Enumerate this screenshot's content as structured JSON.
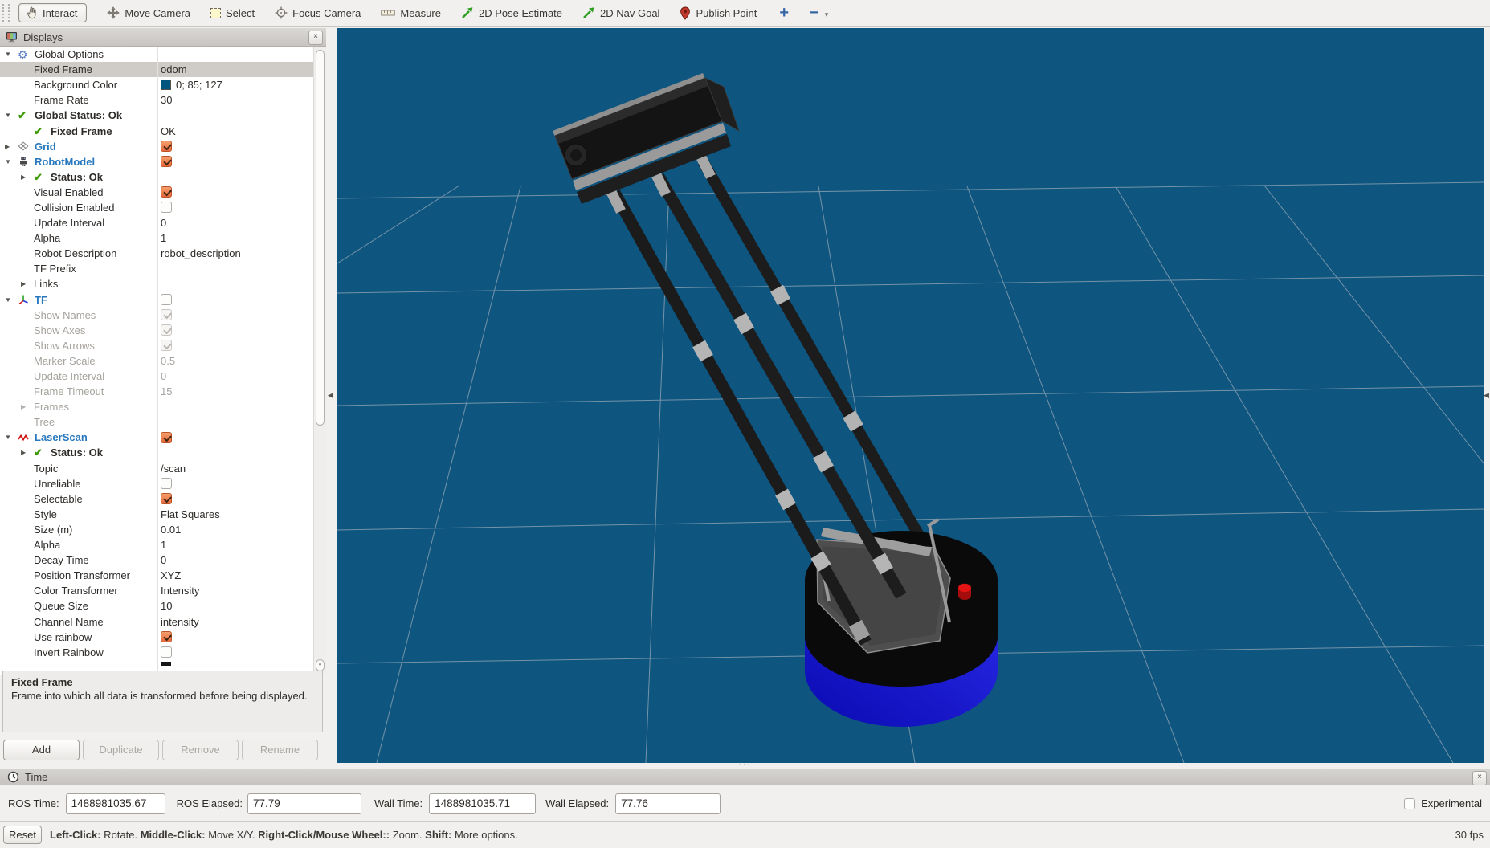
{
  "toolbar": {
    "tools": [
      {
        "label": "Interact",
        "icon": "hand-icon",
        "active": true
      },
      {
        "label": "Move Camera",
        "icon": "move-icon",
        "active": false
      },
      {
        "label": "Select",
        "icon": "select-box-icon",
        "active": false
      },
      {
        "label": "Focus Camera",
        "icon": "crosshair-icon",
        "active": false
      },
      {
        "label": "Measure",
        "icon": "ruler-icon",
        "active": false
      },
      {
        "label": "2D Pose Estimate",
        "icon": "pose-arrow-icon",
        "active": false
      },
      {
        "label": "2D Nav Goal",
        "icon": "nav-arrow-icon",
        "active": false
      },
      {
        "label": "Publish Point",
        "icon": "map-pin-icon",
        "active": false
      }
    ],
    "add_tool_label": "+",
    "remove_tool_label": "−"
  },
  "displays_panel": {
    "title": "Displays",
    "rows": [
      {
        "label": "Global Options",
        "indent": 0,
        "expander": "down",
        "icon": "gear-icon"
      },
      {
        "label": "Fixed Frame",
        "indent": 1,
        "value": "odom",
        "selected": true
      },
      {
        "label": "Background Color",
        "indent": 1,
        "value_color": {
          "swatch": "#00557f",
          "text": "0; 85; 127"
        }
      },
      {
        "label": "Frame Rate",
        "indent": 1,
        "value": "30"
      },
      {
        "label": "Global Status: Ok",
        "indent": 0,
        "expander": "down",
        "icon": "check-icon",
        "bold": true
      },
      {
        "label": "Fixed Frame",
        "indent": 1,
        "icon": "check-icon",
        "bold": true,
        "value": "OK"
      },
      {
        "label": "Grid",
        "indent": 0,
        "expander": "right",
        "icon": "grid-icon",
        "display": true,
        "checkbox": true
      },
      {
        "label": "RobotModel",
        "indent": 0,
        "expander": "down",
        "icon": "robot-icon",
        "display": true,
        "checkbox": true
      },
      {
        "label": "Status: Ok",
        "indent": 1,
        "expander": "right",
        "icon": "check-icon",
        "bold": true
      },
      {
        "label": "Visual Enabled",
        "indent": 1,
        "checkbox": true
      },
      {
        "label": "Collision Enabled",
        "indent": 1,
        "checkbox": false
      },
      {
        "label": "Update Interval",
        "indent": 1,
        "value": "0"
      },
      {
        "label": "Alpha",
        "indent": 1,
        "value": "1"
      },
      {
        "label": "Robot Description",
        "indent": 1,
        "value": "robot_description"
      },
      {
        "label": "TF Prefix",
        "indent": 1
      },
      {
        "label": "Links",
        "indent": 1,
        "expander": "right"
      },
      {
        "label": "TF",
        "indent": 0,
        "expander": "down",
        "icon": "tf-icon",
        "display": true,
        "checkbox": false
      },
      {
        "label": "Show Names",
        "indent": 1,
        "gray": true,
        "checkbox": true,
        "disabled": true
      },
      {
        "label": "Show Axes",
        "indent": 1,
        "gray": true,
        "checkbox": true,
        "disabled": true
      },
      {
        "label": "Show Arrows",
        "indent": 1,
        "gray": true,
        "checkbox": true,
        "disabled": true
      },
      {
        "label": "Marker Scale",
        "indent": 1,
        "gray": true,
        "value": "0.5"
      },
      {
        "label": "Update Interval",
        "indent": 1,
        "gray": true,
        "value": "0"
      },
      {
        "label": "Frame Timeout",
        "indent": 1,
        "gray": true,
        "value": "15"
      },
      {
        "label": "Frames",
        "indent": 1,
        "gray": true,
        "expander": "right"
      },
      {
        "label": "Tree",
        "indent": 1,
        "gray": true
      },
      {
        "label": "LaserScan",
        "indent": 0,
        "expander": "down",
        "icon": "laser-icon",
        "display": true,
        "checkbox": true
      },
      {
        "label": "Status: Ok",
        "indent": 1,
        "expander": "right",
        "icon": "check-icon",
        "bold": true
      },
      {
        "label": "Topic",
        "indent": 1,
        "value": "/scan"
      },
      {
        "label": "Unreliable",
        "indent": 1,
        "checkbox": false
      },
      {
        "label": "Selectable",
        "indent": 1,
        "checkbox": true
      },
      {
        "label": "Style",
        "indent": 1,
        "value": "Flat Squares"
      },
      {
        "label": "Size (m)",
        "indent": 1,
        "value": "0.01"
      },
      {
        "label": "Alpha",
        "indent": 1,
        "value": "1"
      },
      {
        "label": "Decay Time",
        "indent": 1,
        "value": "0"
      },
      {
        "label": "Position Transformer",
        "indent": 1,
        "value": "XYZ"
      },
      {
        "label": "Color Transformer",
        "indent": 1,
        "value": "Intensity"
      },
      {
        "label": "Queue Size",
        "indent": 1,
        "value": "10"
      },
      {
        "label": "Channel Name",
        "indent": 1,
        "value": "intensity"
      },
      {
        "label": "Use rainbow",
        "indent": 1,
        "checkbox": true
      },
      {
        "label": "Invert Rainbow",
        "indent": 1,
        "checkbox": false
      }
    ],
    "help": {
      "title": "Fixed Frame",
      "body": "Frame into which all data is transformed before being displayed."
    },
    "buttons": [
      {
        "label": "Add",
        "enabled": true
      },
      {
        "label": "Duplicate",
        "enabled": false
      },
      {
        "label": "Remove",
        "enabled": false
      },
      {
        "label": "Rename",
        "enabled": false
      }
    ]
  },
  "time_panel": {
    "title": "Time",
    "fields": [
      {
        "label": "ROS Time:",
        "value": "1488981035.67"
      },
      {
        "label": "ROS Elapsed:",
        "value": "77.79"
      },
      {
        "label": "Wall Time:",
        "value": "1488981035.71"
      },
      {
        "label": "Wall Elapsed:",
        "value": "77.76"
      }
    ],
    "experimental_label": "Experimental"
  },
  "status_bar": {
    "reset_label": "Reset",
    "help_segments": [
      {
        "text": "Left-Click:",
        "bold": true
      },
      {
        "text": " Rotate. ",
        "bold": false
      },
      {
        "text": "Middle-Click:",
        "bold": true
      },
      {
        "text": " Move X/Y. ",
        "bold": false
      },
      {
        "text": "Right-Click/Mouse Wheel::",
        "bold": true
      },
      {
        "text": " Zoom. ",
        "bold": false
      },
      {
        "text": "Shift:",
        "bold": true
      },
      {
        "text": " More options.",
        "bold": false
      }
    ],
    "fps": "30 fps"
  },
  "colors": {
    "viewport_background": "#0e5580",
    "grid_line": "#96a9b6",
    "background_color_value": "#00557f",
    "selection": "#cfccc8",
    "checkbox_checked": "#e7683a",
    "display_name": "#2878be",
    "status_green": "#3d9a05",
    "base_blue_light": "#2a2ae8",
    "base_blue_dark": "#0a0ab2",
    "button_red": "#e31414"
  }
}
